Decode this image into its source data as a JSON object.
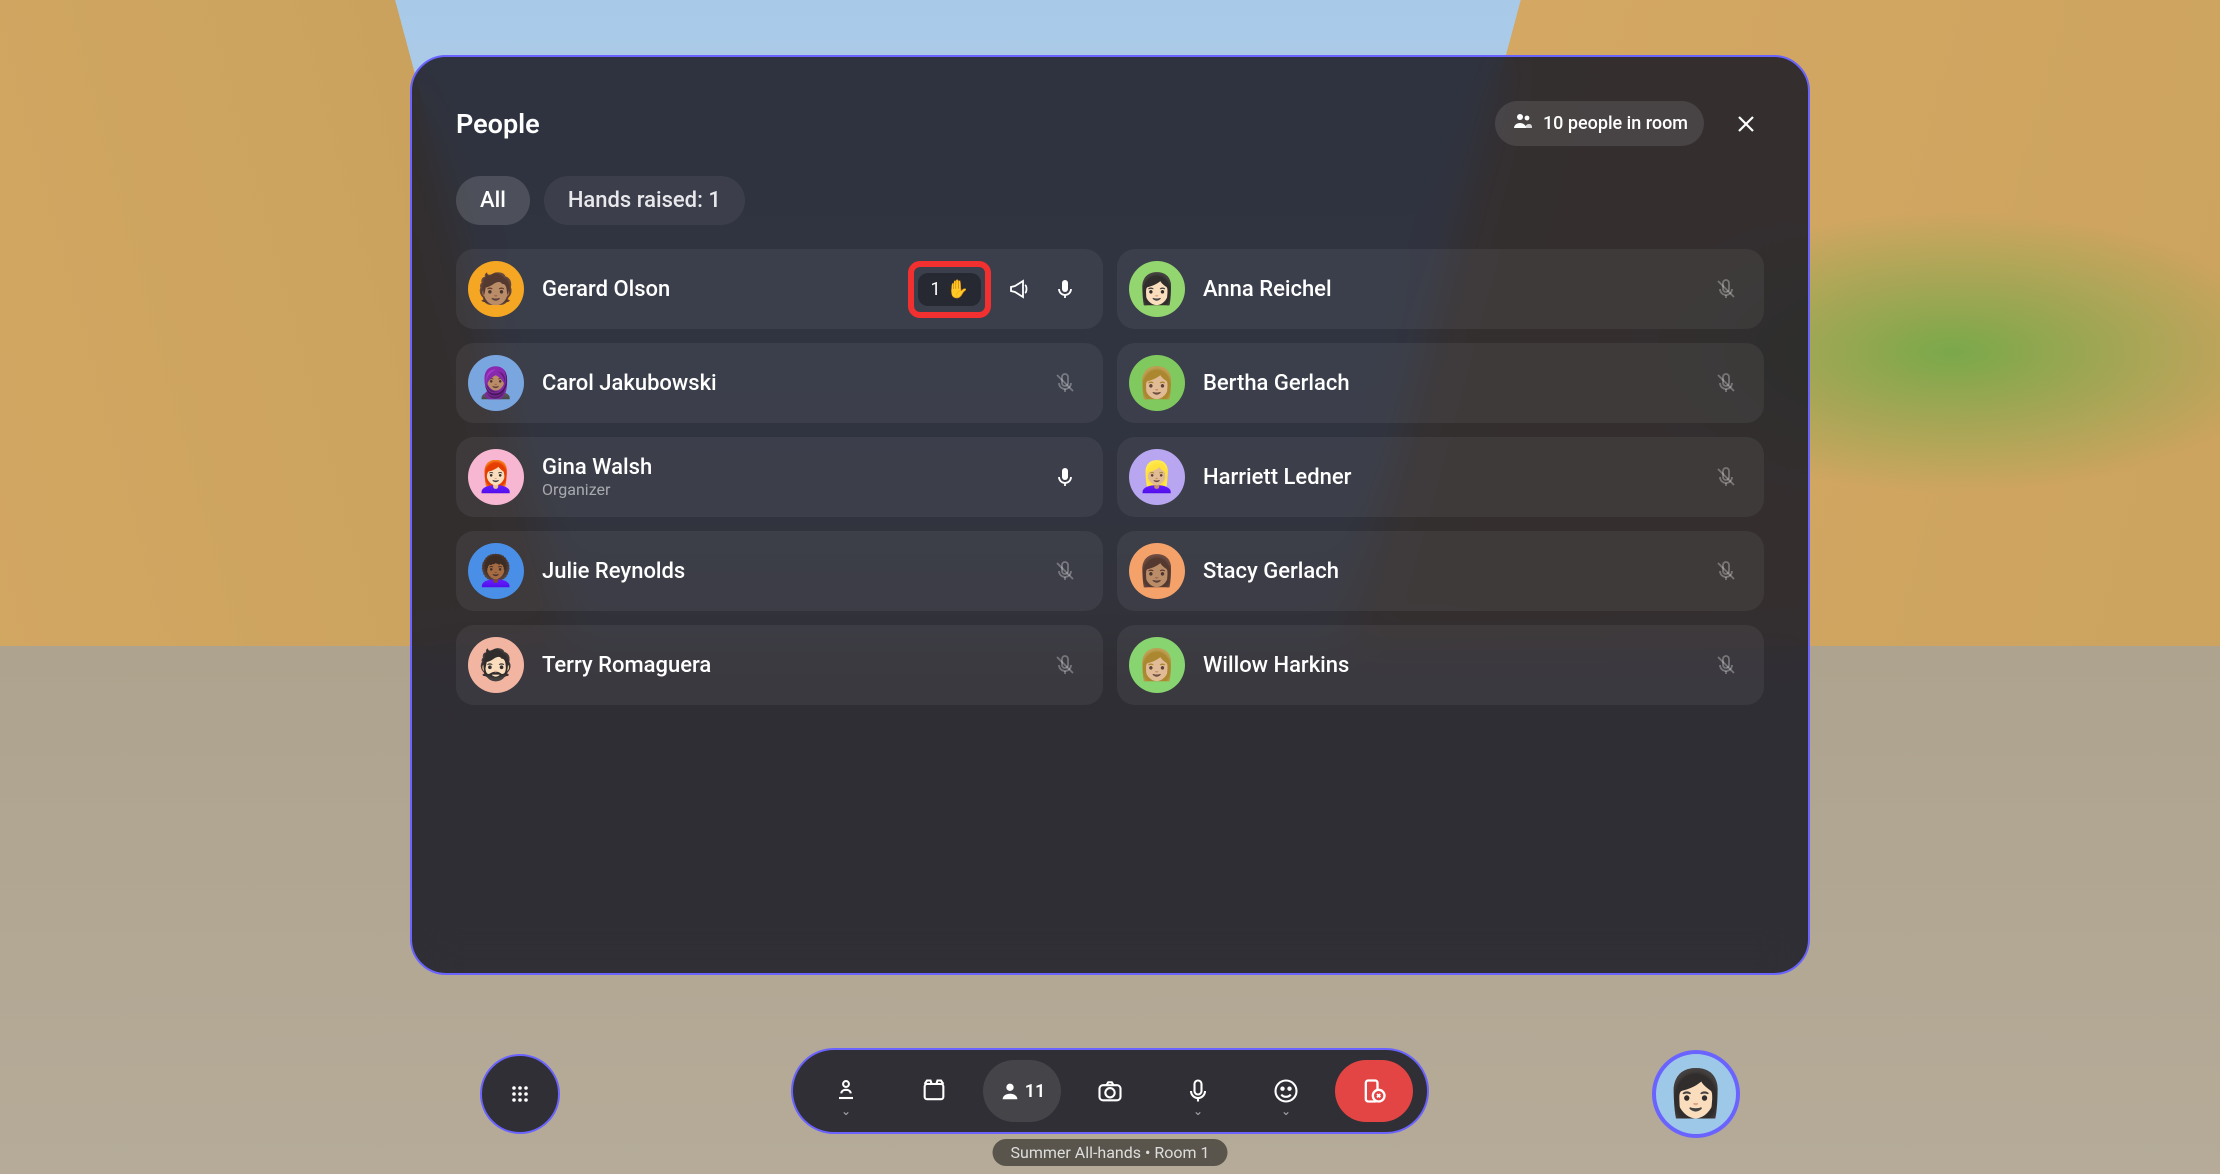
{
  "panel": {
    "title": "People",
    "room_count_label": "10 people in room",
    "tabs": {
      "all": "All",
      "hands_raised": "Hands raised: 1"
    }
  },
  "people": {
    "left": [
      {
        "name": "Gerard Olson",
        "role": "",
        "avatar_bg": "#f5a623",
        "hand_raised": true,
        "hand_order": "1",
        "megaphone": true,
        "mic": "on"
      },
      {
        "name": "Carol Jakubowski",
        "role": "",
        "avatar_bg": "#7aa6e0",
        "mic": "muted"
      },
      {
        "name": "Gina Walsh",
        "role": "Organizer",
        "avatar_bg": "#f7b6d2",
        "mic": "on"
      },
      {
        "name": "Julie Reynolds",
        "role": "",
        "avatar_bg": "#4a8fe7",
        "mic": "muted"
      },
      {
        "name": "Terry Romaguera",
        "role": "",
        "avatar_bg": "#f2b5a2",
        "mic": "muted"
      }
    ],
    "right": [
      {
        "name": "Anna Reichel",
        "role": "",
        "avatar_bg": "#93d66f",
        "mic": "muted"
      },
      {
        "name": "Bertha Gerlach",
        "role": "",
        "avatar_bg": "#7fc95e",
        "mic": "muted"
      },
      {
        "name": "Harriett Ledner",
        "role": "",
        "avatar_bg": "#b8a6f0",
        "mic": "muted"
      },
      {
        "name": "Stacy Gerlach",
        "role": "",
        "avatar_bg": "#f4a16a",
        "mic": "muted"
      },
      {
        "name": "Willow Harkins",
        "role": "",
        "avatar_bg": "#87d470",
        "mic": "muted"
      }
    ]
  },
  "toolbar": {
    "people_count": "11"
  },
  "footer": {
    "room_label": "Summer All-hands • Room 1"
  }
}
